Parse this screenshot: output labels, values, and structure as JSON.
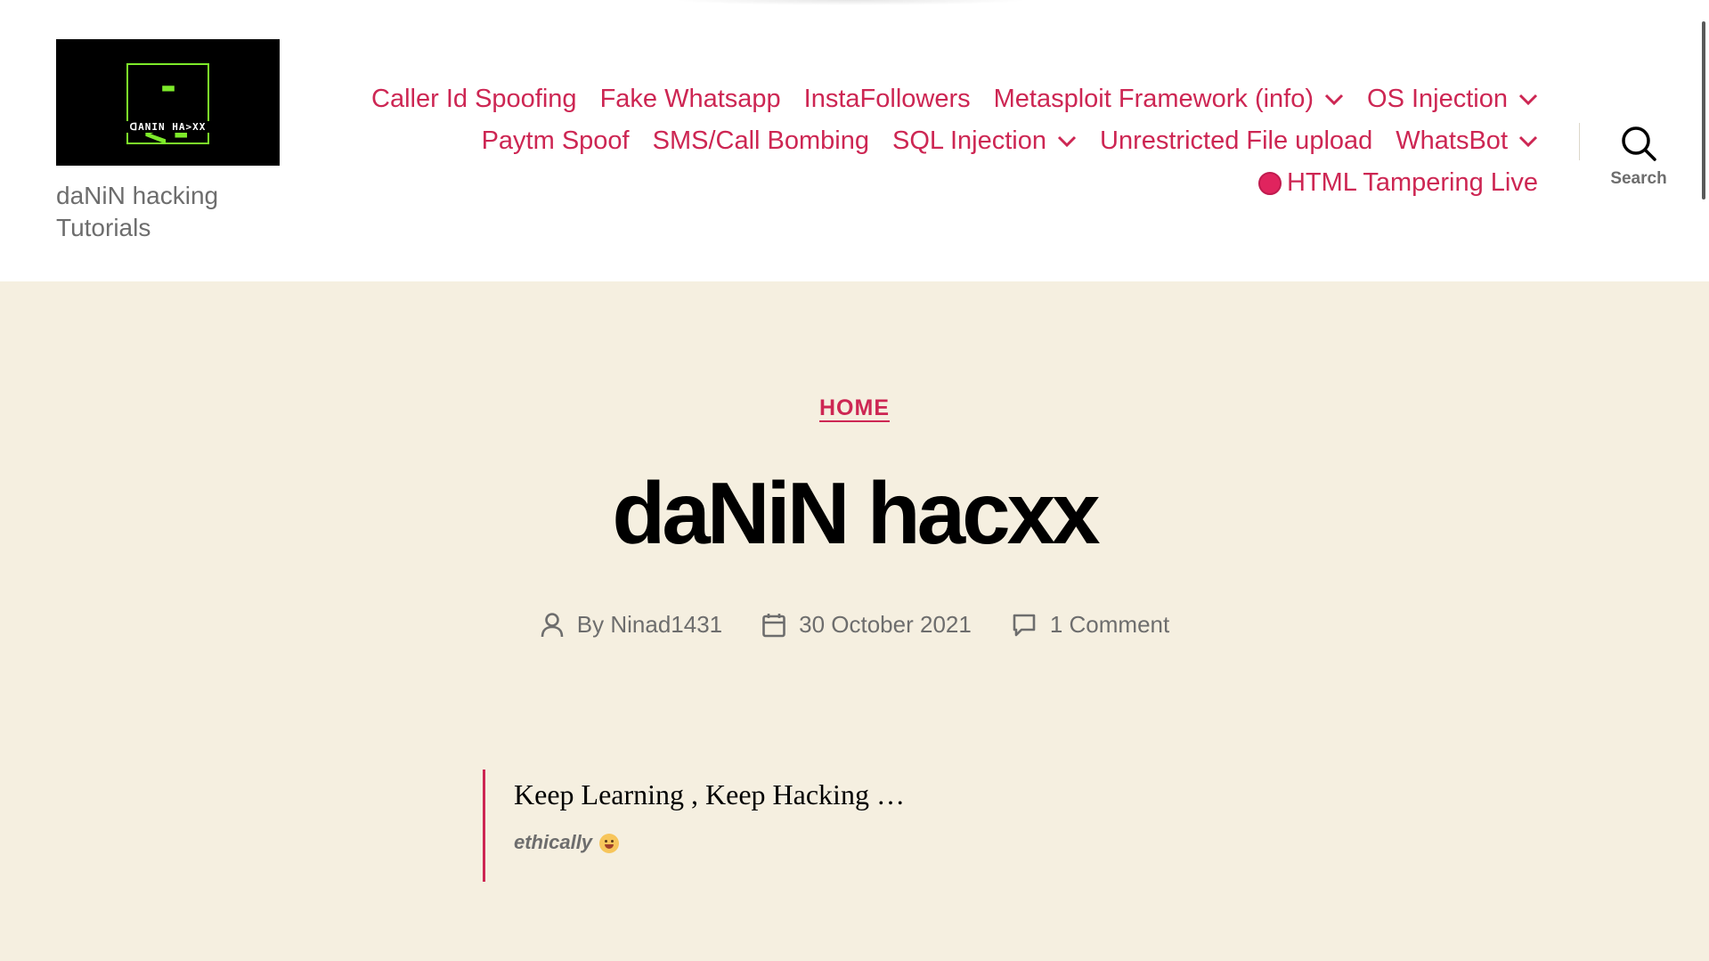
{
  "brand": {
    "logo_symbol": "-<-",
    "logo_text": "ᗡANIN HA>XX",
    "description_line1": "daNiN hacking",
    "description_line2": "Tutorials"
  },
  "nav": {
    "items": [
      {
        "label": "Caller Id Spoofing",
        "has_submenu": false
      },
      {
        "label": "Fake Whatsapp",
        "has_submenu": false
      },
      {
        "label": "InstaFollowers",
        "has_submenu": false
      },
      {
        "label": "Metasploit Framework (info)",
        "has_submenu": true
      },
      {
        "label": "OS Injection",
        "has_submenu": true
      },
      {
        "label": "Paytm Spoof",
        "has_submenu": false
      },
      {
        "label": "SMS/Call Bombing",
        "has_submenu": false
      },
      {
        "label": "SQL Injection",
        "has_submenu": true
      },
      {
        "label": "Unrestricted File upload",
        "has_submenu": false
      },
      {
        "label": "WhatsBot",
        "has_submenu": true
      },
      {
        "label": "HTML Tampering Live",
        "has_submenu": false,
        "icon": "live-dot-icon"
      }
    ],
    "search_label": "Search"
  },
  "entry": {
    "category": "HOME",
    "title": "daNiN hacxx",
    "author_prefix": "By",
    "author": "Ninad1431",
    "date": "30 October 2021",
    "comments": "1 Comment"
  },
  "quote": {
    "text": "Keep Learning , Keep Hacking …",
    "cite": "ethically"
  },
  "colors": {
    "accent": "#cd2653",
    "header_bg": "#ffffff",
    "entry_bg": "#f5efe0",
    "text_secondary": "#6d6d6d",
    "logo_green": "#7dea2a"
  }
}
